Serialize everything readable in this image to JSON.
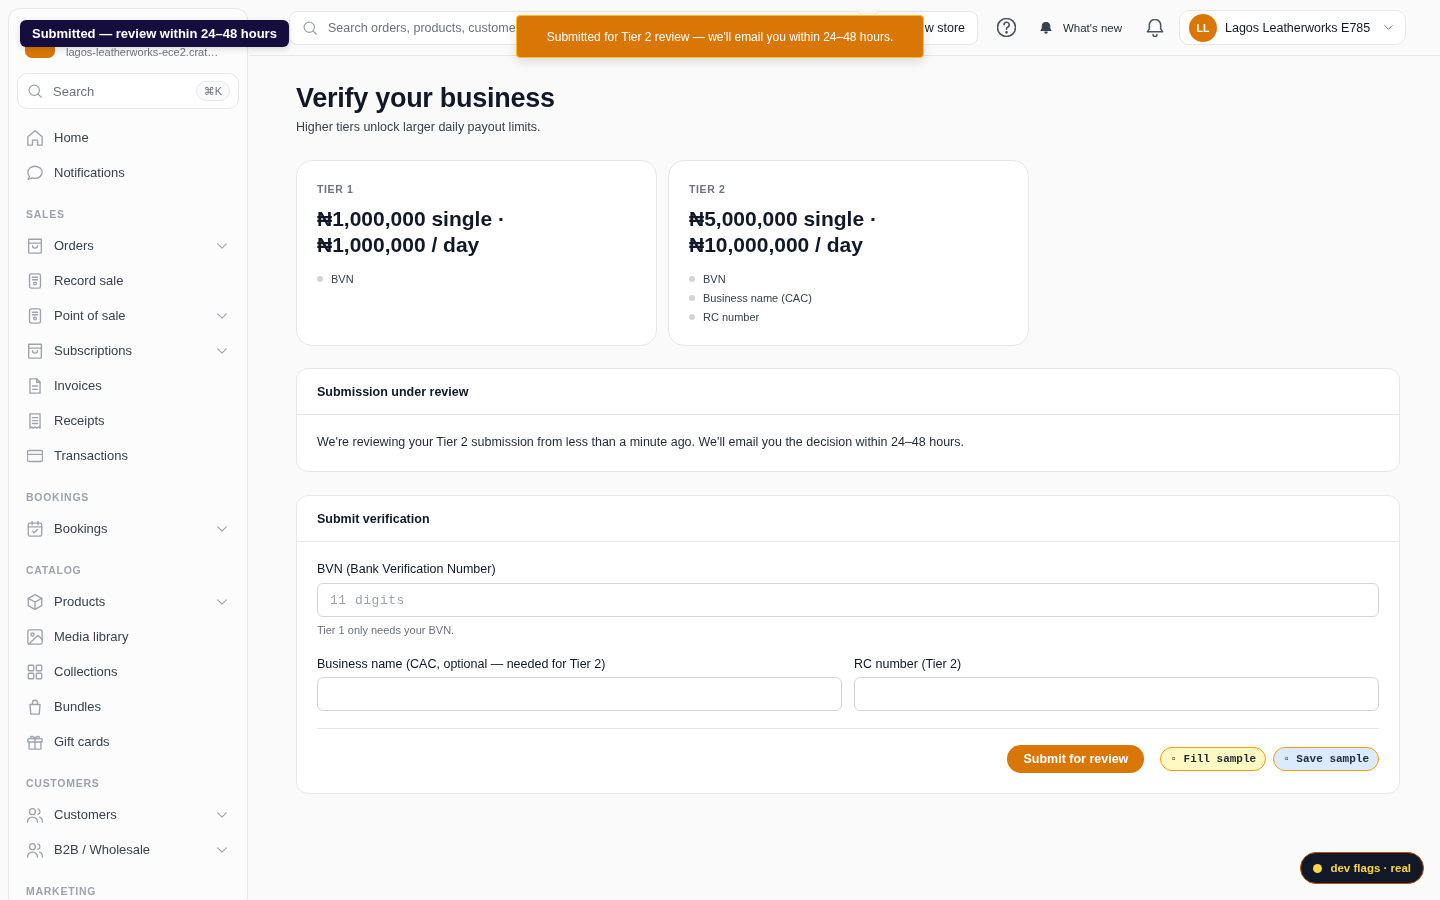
{
  "overlays": {
    "sidebar_tooltip": "Submitted — review within 24–48 hours",
    "toast": "Submitted for Tier 2 review — we'll email you within 24–48 hours."
  },
  "sidebar": {
    "store_subtitle": "lagos-leatherworks-ece2.crat…",
    "search": {
      "placeholder": "Search",
      "shortcut": "⌘K"
    },
    "sections": [
      {
        "items": [
          {
            "label": "Home",
            "expandable": false
          },
          {
            "label": "Notifications",
            "expandable": false
          }
        ]
      },
      {
        "heading": "SALES",
        "items": [
          {
            "label": "Orders",
            "expandable": true
          },
          {
            "label": "Record sale",
            "expandable": false
          },
          {
            "label": "Point of sale",
            "expandable": true
          },
          {
            "label": "Subscriptions",
            "expandable": true
          },
          {
            "label": "Invoices",
            "expandable": false
          },
          {
            "label": "Receipts",
            "expandable": false
          },
          {
            "label": "Transactions",
            "expandable": false
          }
        ]
      },
      {
        "heading": "BOOKINGS",
        "items": [
          {
            "label": "Bookings",
            "expandable": true
          }
        ]
      },
      {
        "heading": "CATALOG",
        "items": [
          {
            "label": "Products",
            "expandable": true
          },
          {
            "label": "Media library",
            "expandable": false
          },
          {
            "label": "Collections",
            "expandable": false
          },
          {
            "label": "Bundles",
            "expandable": false
          },
          {
            "label": "Gift cards",
            "expandable": false
          }
        ]
      },
      {
        "heading": "CUSTOMERS",
        "items": [
          {
            "label": "Customers",
            "expandable": true
          },
          {
            "label": "B2B / Wholesale",
            "expandable": true
          }
        ]
      },
      {
        "heading": "MARKETING"
      }
    ]
  },
  "topbar": {
    "search": {
      "placeholder": "Search orders, products, custome"
    },
    "store_button": "w store",
    "whats_new": "What's new",
    "account": {
      "initials": "LL",
      "name": "Lagos Leatherworks E785"
    }
  },
  "page": {
    "title": "Verify your business",
    "subtitle": "Higher tiers unlock larger daily payout limits."
  },
  "tiers": [
    {
      "label": "TIER 1",
      "limits": "₦1,000,000 single · ₦1,000,000 / day",
      "requirements": [
        "BVN"
      ]
    },
    {
      "label": "TIER 2",
      "limits": "₦5,000,000 single · ₦10,000,000 / day",
      "requirements": [
        "BVN",
        "Business name (CAC)",
        "RC number"
      ]
    }
  ],
  "review_panel": {
    "title": "Submission under review",
    "message": "We're reviewing your Tier 2 submission from less than a minute ago. We'll email you the decision within 24–48 hours."
  },
  "form": {
    "title": "Submit verification",
    "rows": [
      [
        {
          "label": "BVN (Bank Verification Number)",
          "placeholder": "11 digits",
          "help": "Tier 1 only needs your BVN."
        }
      ],
      [
        {
          "label": "Business name (CAC, optional — needed for Tier 2)"
        },
        {
          "label": "RC number (Tier 2)"
        }
      ]
    ],
    "actions": [
      {
        "label": "Submit for review",
        "kind": "primary"
      },
      {
        "label": "▫ Fill sample",
        "kind": "dev",
        "color": "#fef9c3"
      },
      {
        "label": "▫ Save sample",
        "kind": "dev",
        "color": "#dbeafe"
      }
    ]
  },
  "dev_badge": {
    "label": "dev flags · real"
  }
}
